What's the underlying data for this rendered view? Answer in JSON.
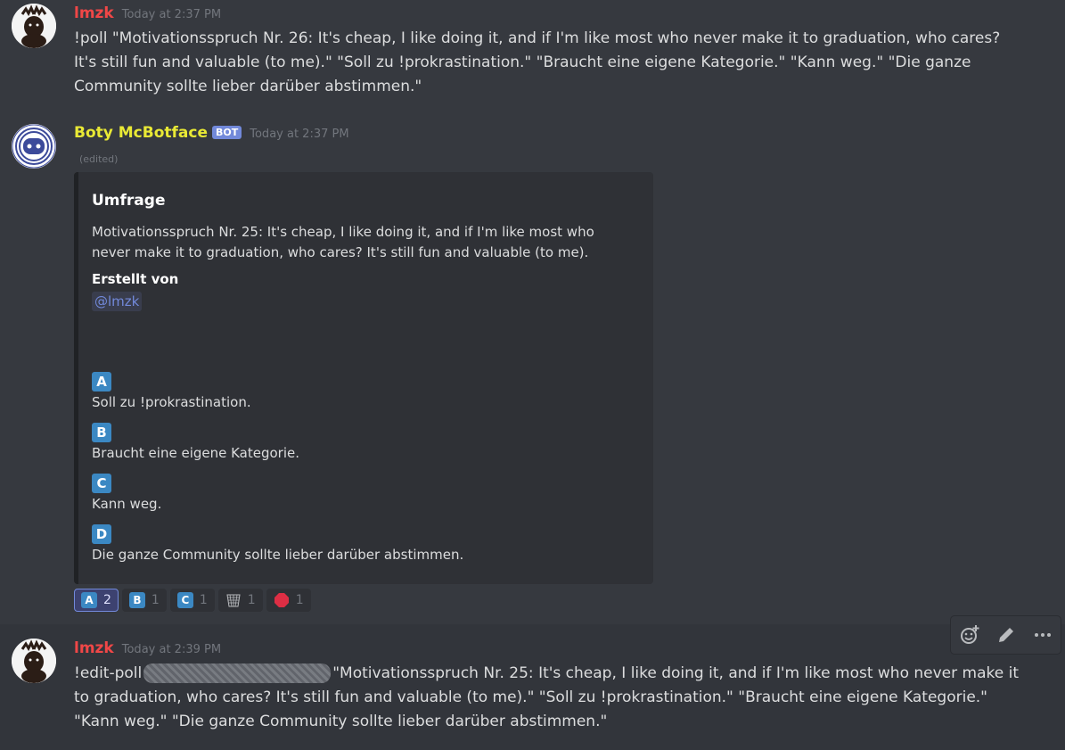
{
  "messages": [
    {
      "username": "lmzk",
      "timestamp": "Today at 2:37 PM",
      "text": "!poll \"Motivationsspruch Nr. 26: It's cheap, I like doing it, and if I'm like most who never make it to graduation, who cares? It's still fun and valuable (to me).\" \"Soll zu !prokrastination.\" \"Braucht eine eigene Kategorie.\" \"Kann weg.\" \"Die ganze Community sollte lieber darüber abstimmen.\""
    },
    {
      "username": "Boty McBotface",
      "badge": "BOT",
      "timestamp": "Today at 2:37 PM",
      "edited": "(edited)",
      "embed": {
        "title": "Umfrage",
        "description": "Motivationsspruch Nr. 25: It's cheap, I like doing it, and if I'm like most who never make it to graduation, who cares? It's still fun and valuable (to me).",
        "field_name": "Erstellt von",
        "field_value": "@lmzk",
        "options": [
          {
            "letter": "A",
            "text": "Soll zu !prokrastination."
          },
          {
            "letter": "B",
            "text": "Braucht eine eigene Kategorie."
          },
          {
            "letter": "C",
            "text": "Kann weg."
          },
          {
            "letter": "D",
            "text": "Die ganze Community sollte lieber darüber abstimmen."
          }
        ]
      },
      "reactions": [
        {
          "emoji": "A",
          "count": "2",
          "active": true
        },
        {
          "emoji": "B",
          "count": "1"
        },
        {
          "emoji": "C",
          "count": "1"
        },
        {
          "emoji": "basket-icon",
          "count": "1"
        },
        {
          "emoji": "stop-sign-icon",
          "count": "1"
        }
      ]
    },
    {
      "username": "lmzk",
      "timestamp": "Today at 2:39 PM",
      "text_prefix": "!edit-poll",
      "text_suffix": "\"Motivationsspruch Nr. 25: It's cheap, I like doing it, and if I'm like most who never make it to graduation, who cares? It's still fun and valuable (to me).\" \"Soll zu !prokrastination.\" \"Braucht eine eigene Kategorie.\" \"Kann weg.\" \"Die ganze Community sollte lieber darüber abstimmen.\""
    }
  ],
  "colors": {
    "user": "#f04747",
    "bot": "#e9e935",
    "blurple": "#7289da",
    "regional": "#3b88c3"
  }
}
